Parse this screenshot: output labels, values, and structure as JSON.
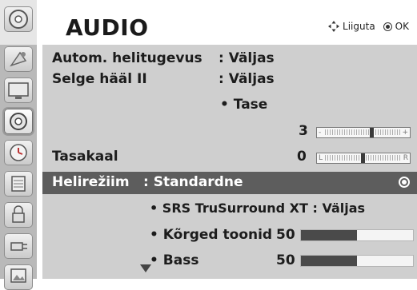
{
  "header": {
    "title": "AUDIO",
    "nav_move_label": "Liiguta",
    "nav_ok_label": "OK"
  },
  "sidebar": {
    "icons": [
      "disc-icon",
      "satellite-icon",
      "monitor-icon",
      "speaker-icon",
      "clock-icon",
      "calendar-icon",
      "lock-icon",
      "plug-icon",
      "photo-icon"
    ],
    "active_index": 3
  },
  "menu": {
    "auto_volume": {
      "label": "Autom. helitugevus",
      "value": ": Väljas"
    },
    "clear_voice": {
      "label": "Selge hääl II",
      "value": ": Väljas"
    },
    "level": {
      "label": "• Tase",
      "value": "3",
      "range": "-|+"
    },
    "balance": {
      "label": "Tasakaal",
      "value": "0",
      "left": "L",
      "right": "R"
    },
    "sound_mode": {
      "label": "Helirežiim",
      "value": ": Standardne"
    },
    "srs": {
      "label": "• SRS TruSurround XT : Väljas"
    },
    "treble": {
      "label": "• Kõrged toonid",
      "value": "50",
      "fraction": 0.5
    },
    "bass": {
      "label": "• Bass",
      "value": "50",
      "fraction": 0.5
    }
  },
  "colors": {
    "panel": "#cfcfcf",
    "highlight": "#5d5d5d",
    "sidebar": "#b9b9b9"
  }
}
